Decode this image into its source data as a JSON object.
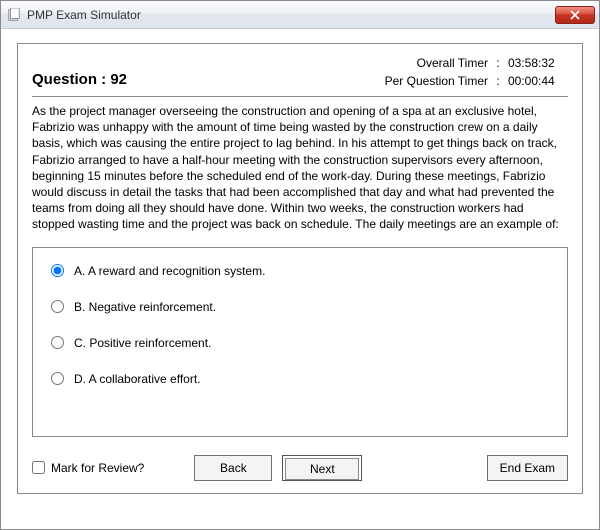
{
  "window": {
    "title": "PMP Exam Simulator"
  },
  "timers": {
    "overall_label": "Overall Timer",
    "overall_value": "03:58:32",
    "perq_label": "Per Question Timer",
    "perq_value": "00:00:44"
  },
  "question": {
    "label": "Question : 92",
    "text": "As the project manager overseeing the construction and opening of a spa at an exclusive hotel, Fabrizio was unhappy with the amount of time being wasted by the construction crew on a daily basis, which was causing the entire project to lag behind. In his attempt to get things back on track, Fabrizio arranged to have a half-hour meeting with the construction supervisors every afternoon, beginning 15 minutes before the scheduled end of the work-day. During these meetings, Fabrizio would discuss in detail the tasks that had been accomplished that day and what had prevented the teams from doing all they should have done. Within two weeks, the construction workers had stopped wasting time and the project was back on schedule. The daily meetings are an example of:"
  },
  "options": [
    {
      "label": "A. A reward and recognition system.",
      "selected": true
    },
    {
      "label": "B. Negative reinforcement.",
      "selected": false
    },
    {
      "label": "C. Positive reinforcement.",
      "selected": false
    },
    {
      "label": "D. A collaborative effort.",
      "selected": false
    }
  ],
  "footer": {
    "mark_label": "Mark for Review?",
    "back": "Back",
    "next": "Next",
    "end": "End Exam"
  }
}
